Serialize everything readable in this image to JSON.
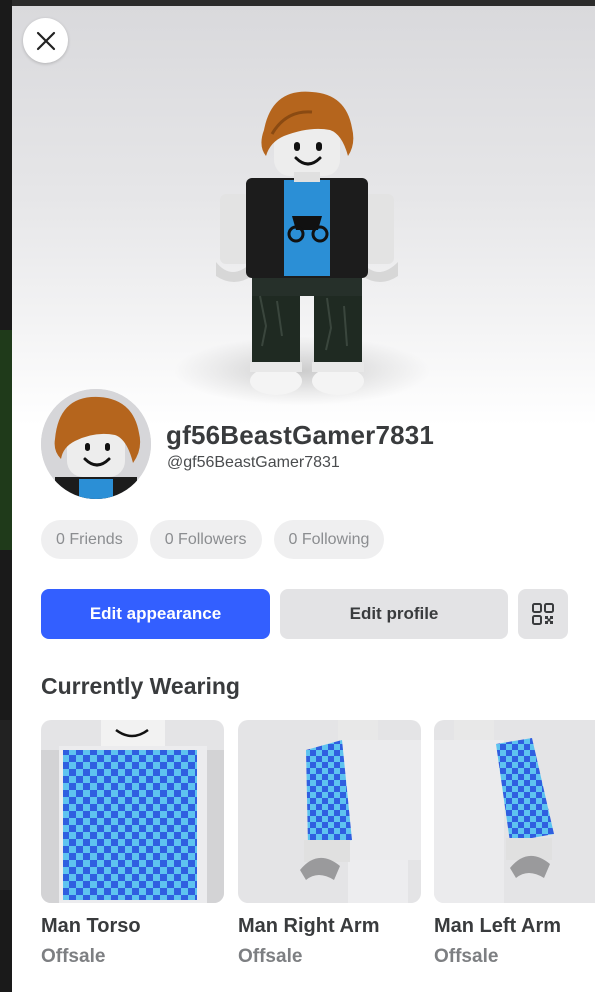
{
  "close_icon": "close-icon",
  "profile": {
    "display_name": "gf56BeastGamer7831",
    "username": "@gf56BeastGamer7831"
  },
  "stats": {
    "friends": "0 Friends",
    "followers": "0 Followers",
    "following": "0 Following"
  },
  "actions": {
    "edit_appearance": "Edit appearance",
    "edit_profile": "Edit profile",
    "qr_icon": "qr-code-icon"
  },
  "wearing": {
    "title": "Currently Wearing",
    "items": [
      {
        "name": "Man Torso",
        "price": "Offsale"
      },
      {
        "name": "Man Right Arm",
        "price": "Offsale"
      },
      {
        "name": "Man Left Arm",
        "price": "Offsale"
      }
    ]
  },
  "colors": {
    "primary": "#335fff",
    "text": "#393b3d",
    "muted": "#7d7f82",
    "chip_bg": "#efeff0",
    "hair": "#b5651d",
    "skin": "#ececec",
    "shirt": "#2b8fd6",
    "jacket": "#1c1c1c",
    "checker_a": "#2f5fe0",
    "checker_b": "#5ec3f0"
  }
}
